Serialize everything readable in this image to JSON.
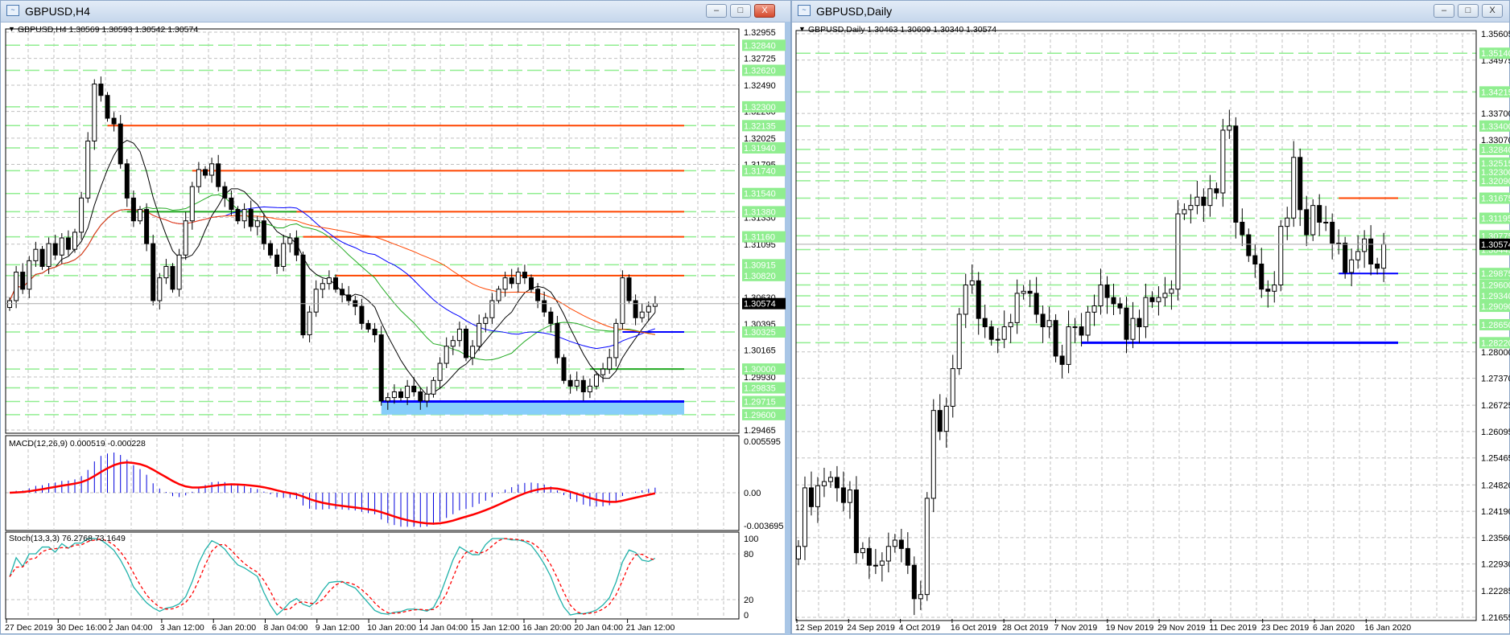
{
  "left_window": {
    "title": "GBPUSD,H4",
    "header": "GBPUSD,H4  1.30569 1.30593 1.30542 1.30574",
    "macd_label": "MACD(12,26,9) 0.000519 -0.000228",
    "stoch_label": "Stoch(13,3,3) 76.2768 73.1649",
    "buttons": {
      "minimize": "–",
      "maximize": "□",
      "close": "X"
    },
    "price_labels": [
      "1.32955",
      "1.32725",
      "1.32490",
      "1.32260",
      "1.32025",
      "1.31795",
      "1.31330",
      "1.31095",
      "1.30630",
      "1.30395",
      "1.30165",
      "1.29930",
      "1.29465"
    ],
    "level_labels": [
      "1.32840",
      "1.32620",
      "1.32300",
      "1.32135",
      "1.31940",
      "1.31740",
      "1.31540",
      "1.31380",
      "1.31160",
      "1.30915",
      "1.30820",
      "1.30325",
      "1.30000",
      "1.29835",
      "1.29715",
      "1.29600"
    ],
    "current_price": "1.30574",
    "macd_axis": [
      "0.005595",
      "0.00",
      "-0.003695"
    ],
    "stoch_axis": [
      "100",
      "80",
      "20",
      "0"
    ],
    "time_labels": [
      "27 Dec 2019",
      "30 Dec 16:00",
      "2 Jan 04:00",
      "3 Jan 12:00",
      "6 Jan 20:00",
      "8 Jan 04:00",
      "9 Jan 12:00",
      "10 Jan 20:00",
      "14 Jan 04:00",
      "15 Jan 12:00",
      "16 Jan 20:00",
      "20 Jan 04:00",
      "21 Jan 12:00"
    ],
    "lines": [
      {
        "price": 1.32135,
        "color": "#ff4500",
        "from": 15
      },
      {
        "price": 1.3174,
        "color": "#ff4500",
        "from": 28
      },
      {
        "price": 1.3138,
        "color": "#ff4500",
        "from": 43
      },
      {
        "price": 1.3138,
        "color": "#22aa22",
        "from": 18,
        "to": 44
      },
      {
        "price": 1.3116,
        "color": "#ff4500",
        "from": 45
      },
      {
        "price": 1.3082,
        "color": "#ff4500",
        "from": 50
      },
      {
        "price": 1.30325,
        "color": "#0000ff",
        "from": 94
      },
      {
        "price": 1.3,
        "color": "#22aa22",
        "from": 89
      },
      {
        "price": 1.29715,
        "color": "#0000ff",
        "from": 57,
        "thick": true
      }
    ],
    "zone": {
      "top": 1.29715,
      "bottom": 1.296,
      "from": 57,
      "color": "#87cefa"
    },
    "closes": [
      1.306,
      1.3085,
      1.307,
      1.3095,
      1.3105,
      1.309,
      1.311,
      1.31,
      1.3115,
      1.3105,
      1.312,
      1.315,
      1.32,
      1.325,
      1.324,
      1.322,
      1.3215,
      1.318,
      1.315,
      1.313,
      1.314,
      1.311,
      1.306,
      1.308,
      1.309,
      1.307,
      1.31,
      1.313,
      1.316,
      1.3175,
      1.317,
      1.318,
      1.316,
      1.315,
      1.314,
      1.313,
      1.314,
      1.3125,
      1.313,
      1.311,
      1.31,
      1.309,
      1.311,
      1.3115,
      1.31,
      1.303,
      1.305,
      1.307,
      1.3075,
      1.308,
      1.307,
      1.3065,
      1.306,
      1.3055,
      1.304,
      1.3035,
      1.303,
      1.2972,
      1.2975,
      1.298,
      1.2975,
      1.2985,
      1.298,
      1.2972,
      1.2978,
      1.299,
      1.3005,
      1.302,
      1.3025,
      1.3035,
      1.301,
      1.302,
      1.304,
      1.3045,
      1.306,
      1.307,
      1.308,
      1.3075,
      1.3085,
      1.308,
      1.307,
      1.306,
      1.305,
      1.304,
      1.301,
      1.299,
      1.2985,
      1.299,
      1.298,
      1.2985,
      1.2995,
      1.3,
      1.301,
      1.304,
      1.308,
      1.306,
      1.3045,
      1.305,
      1.3055,
      1.30574
    ],
    "ma": [
      {
        "period": 8,
        "color": "#000000"
      },
      {
        "period": 21,
        "color": "#22aa22"
      },
      {
        "period": 34,
        "color": "#0000ff"
      },
      {
        "period": 55,
        "color": "#ff4500"
      }
    ]
  },
  "right_window": {
    "title": "GBPUSD,Daily",
    "header": "GBPUSD,Daily  1.30463 1.30609 1.30340 1.30574",
    "buttons": {
      "minimize": "–",
      "maximize": "□",
      "close": "X"
    },
    "price_labels": [
      "1.35605",
      "1.34975",
      "1.33700",
      "1.33070",
      "1.28000",
      "1.27370",
      "1.26725",
      "1.26095",
      "1.25465",
      "1.24820",
      "1.24190",
      "1.23560",
      "1.22930",
      "1.22285",
      "1.21655"
    ],
    "level_labels": [
      "1.35140",
      "1.34215",
      "1.33400",
      "1.32840",
      "1.32515",
      "1.32300",
      "1.32090",
      "1.31675",
      "1.31195",
      "1.30775",
      "1.30445",
      "1.29875",
      "1.29600",
      "1.29340",
      "1.29090",
      "1.28650",
      "1.28220"
    ],
    "current_price": "1.30574",
    "time_labels": [
      "12 Sep 2019",
      "24 Sep 2019",
      "4 Oct 2019",
      "16 Oct 2019",
      "28 Oct 2019",
      "7 Nov 2019",
      "19 Nov 2019",
      "29 Nov 2019",
      "11 Dec 2019",
      "23 Dec 2019",
      "6 Jan 2020",
      "16 Jan 2020"
    ],
    "lines": [
      {
        "price": 1.31675,
        "color": "#ff4500",
        "from": 84
      },
      {
        "price": 1.29875,
        "color": "#0000ff",
        "from": 84
      },
      {
        "price": 1.2822,
        "color": "#0000ff",
        "from": 44,
        "thick": true
      }
    ],
    "closes": [
      1.2335,
      1.2475,
      1.243,
      1.248,
      1.249,
      1.25,
      1.2475,
      1.244,
      1.247,
      1.232,
      1.233,
      1.229,
      1.229,
      1.23,
      1.2335,
      1.235,
      1.233,
      1.229,
      1.221,
      1.222,
      1.245,
      1.266,
      1.261,
      1.267,
      1.276,
      1.289,
      1.296,
      1.297,
      1.288,
      1.286,
      1.283,
      1.283,
      1.286,
      1.287,
      1.294,
      1.2945,
      1.294,
      1.289,
      1.286,
      1.2875,
      1.279,
      1.277,
      1.286,
      1.286,
      1.284,
      1.2895,
      1.291,
      1.296,
      1.293,
      1.2915,
      1.2905,
      1.283,
      1.288,
      1.286,
      1.293,
      1.292,
      1.293,
      1.294,
      1.295,
      1.313,
      1.314,
      1.315,
      1.317,
      1.315,
      1.319,
      1.318,
      1.333,
      1.334,
      1.311,
      1.308,
      1.303,
      1.301,
      1.295,
      1.2945,
      1.296,
      1.31,
      1.312,
      1.3265,
      1.314,
      1.308,
      1.315,
      1.311,
      1.311,
      1.306,
      1.306,
      1.299,
      1.302,
      1.304,
      1.307,
      1.301,
      1.3,
      1.30574
    ]
  },
  "colors": {
    "level_green": "#90ee90",
    "grid": "#c0c0c0",
    "macd_hist": "#0000dd",
    "macd_signal": "#ff0000",
    "stoch_main": "#20b2aa",
    "stoch_signal": "#ff0000",
    "bull": "#ffffff",
    "bear": "#000000"
  }
}
